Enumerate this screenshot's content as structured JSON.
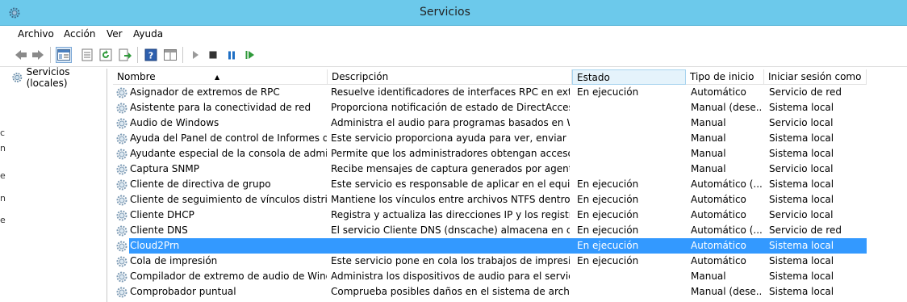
{
  "window": {
    "title": "Servicios"
  },
  "menu": [
    "Archivo",
    "Acción",
    "Ver",
    "Ayuda"
  ],
  "tree": {
    "root_label": "Servicios (locales)"
  },
  "left_edge_glyphs": [
    "c",
    "n",
    "e",
    "n",
    "e"
  ],
  "columns": [
    "Nombre",
    "Descripción",
    "Estado",
    "Tipo de inicio",
    "Iniciar sesión como"
  ],
  "rows": [
    {
      "name": "Asignador de extremos de RPC",
      "desc": "Resuelve identificadores de interfaces RPC en extremo...",
      "status": "En ejecución",
      "start": "Automático",
      "logon": "Servicio de red"
    },
    {
      "name": "Asistente para la conectividad de red",
      "desc": "Proporciona notificación de estado de DirectAccess p...",
      "status": "",
      "start": "Manual (dese...",
      "logon": "Sistema local"
    },
    {
      "name": "Audio de Windows",
      "desc": "Administra el audio para programas basados en Wind...",
      "status": "",
      "start": "Manual",
      "logon": "Servicio local"
    },
    {
      "name": "Ayuda del Panel de control de Informes de ...",
      "desc": "Este servicio proporciona ayuda para ver, enviar y borr...",
      "status": "",
      "start": "Manual",
      "logon": "Sistema local"
    },
    {
      "name": "Ayudante especial de la consola de adminis...",
      "desc": "Permite que los administradores obtengan acceso de ...",
      "status": "",
      "start": "Manual",
      "logon": "Sistema local"
    },
    {
      "name": "Captura SNMP",
      "desc": "Recibe mensajes de captura generados por agentes lo...",
      "status": "",
      "start": "Manual",
      "logon": "Servicio local"
    },
    {
      "name": "Cliente de directiva de grupo",
      "desc": "Este servicio es responsable de aplicar en el equipo y l...",
      "status": "En ejecución",
      "start": "Automático (...",
      "logon": "Sistema local"
    },
    {
      "name": "Cliente de seguimiento de vínculos distribui...",
      "desc": "Mantiene los vínculos entre archivos NTFS dentro de ...",
      "status": "En ejecución",
      "start": "Automático",
      "logon": "Sistema local"
    },
    {
      "name": "Cliente DHCP",
      "desc": "Registra y actualiza las direcciones IP y los registros D...",
      "status": "En ejecución",
      "start": "Automático",
      "logon": "Servicio local"
    },
    {
      "name": "Cliente DNS",
      "desc": "El servicio Cliente DNS (dnscache) almacena en caché...",
      "status": "En ejecución",
      "start": "Automático (...",
      "logon": "Servicio de red"
    },
    {
      "name": "Cloud2Prn",
      "desc": "",
      "status": "En ejecución",
      "start": "Automático",
      "logon": "Sistema local",
      "selected": true
    },
    {
      "name": "Cola de impresión",
      "desc": "Este servicio pone en cola los trabajos de impresión y ...",
      "status": "En ejecución",
      "start": "Automático",
      "logon": "Sistema local"
    },
    {
      "name": "Compilador de extremo de audio de Windo...",
      "desc": "Administra los dispositivos de audio para el servicio d...",
      "status": "",
      "start": "Manual",
      "logon": "Sistema local"
    },
    {
      "name": "Comprobador puntual",
      "desc": "Comprueba posibles daños en el sistema de archivos.",
      "status": "",
      "start": "Manual (dese...",
      "logon": "Sistema local"
    }
  ]
}
